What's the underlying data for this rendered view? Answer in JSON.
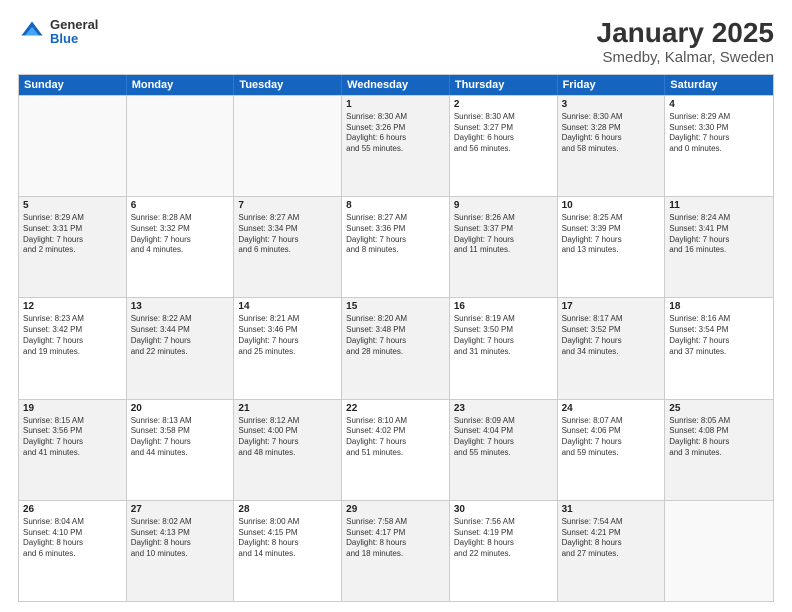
{
  "logo": {
    "general": "General",
    "blue": "Blue"
  },
  "title": "January 2025",
  "subtitle": "Smedby, Kalmar, Sweden",
  "weekdays": [
    "Sunday",
    "Monday",
    "Tuesday",
    "Wednesday",
    "Thursday",
    "Friday",
    "Saturday"
  ],
  "rows": [
    [
      {
        "day": "",
        "info": "",
        "empty": true
      },
      {
        "day": "",
        "info": "",
        "empty": true
      },
      {
        "day": "",
        "info": "",
        "empty": true
      },
      {
        "day": "1",
        "info": "Sunrise: 8:30 AM\nSunset: 3:26 PM\nDaylight: 6 hours\nand 55 minutes.",
        "shaded": true
      },
      {
        "day": "2",
        "info": "Sunrise: 8:30 AM\nSunset: 3:27 PM\nDaylight: 6 hours\nand 56 minutes.",
        "shaded": false
      },
      {
        "day": "3",
        "info": "Sunrise: 8:30 AM\nSunset: 3:28 PM\nDaylight: 6 hours\nand 58 minutes.",
        "shaded": true
      },
      {
        "day": "4",
        "info": "Sunrise: 8:29 AM\nSunset: 3:30 PM\nDaylight: 7 hours\nand 0 minutes.",
        "shaded": false
      }
    ],
    [
      {
        "day": "5",
        "info": "Sunrise: 8:29 AM\nSunset: 3:31 PM\nDaylight: 7 hours\nand 2 minutes.",
        "shaded": true
      },
      {
        "day": "6",
        "info": "Sunrise: 8:28 AM\nSunset: 3:32 PM\nDaylight: 7 hours\nand 4 minutes.",
        "shaded": false
      },
      {
        "day": "7",
        "info": "Sunrise: 8:27 AM\nSunset: 3:34 PM\nDaylight: 7 hours\nand 6 minutes.",
        "shaded": true
      },
      {
        "day": "8",
        "info": "Sunrise: 8:27 AM\nSunset: 3:36 PM\nDaylight: 7 hours\nand 8 minutes.",
        "shaded": false
      },
      {
        "day": "9",
        "info": "Sunrise: 8:26 AM\nSunset: 3:37 PM\nDaylight: 7 hours\nand 11 minutes.",
        "shaded": true
      },
      {
        "day": "10",
        "info": "Sunrise: 8:25 AM\nSunset: 3:39 PM\nDaylight: 7 hours\nand 13 minutes.",
        "shaded": false
      },
      {
        "day": "11",
        "info": "Sunrise: 8:24 AM\nSunset: 3:41 PM\nDaylight: 7 hours\nand 16 minutes.",
        "shaded": true
      }
    ],
    [
      {
        "day": "12",
        "info": "Sunrise: 8:23 AM\nSunset: 3:42 PM\nDaylight: 7 hours\nand 19 minutes.",
        "shaded": false
      },
      {
        "day": "13",
        "info": "Sunrise: 8:22 AM\nSunset: 3:44 PM\nDaylight: 7 hours\nand 22 minutes.",
        "shaded": true
      },
      {
        "day": "14",
        "info": "Sunrise: 8:21 AM\nSunset: 3:46 PM\nDaylight: 7 hours\nand 25 minutes.",
        "shaded": false
      },
      {
        "day": "15",
        "info": "Sunrise: 8:20 AM\nSunset: 3:48 PM\nDaylight: 7 hours\nand 28 minutes.",
        "shaded": true
      },
      {
        "day": "16",
        "info": "Sunrise: 8:19 AM\nSunset: 3:50 PM\nDaylight: 7 hours\nand 31 minutes.",
        "shaded": false
      },
      {
        "day": "17",
        "info": "Sunrise: 8:17 AM\nSunset: 3:52 PM\nDaylight: 7 hours\nand 34 minutes.",
        "shaded": true
      },
      {
        "day": "18",
        "info": "Sunrise: 8:16 AM\nSunset: 3:54 PM\nDaylight: 7 hours\nand 37 minutes.",
        "shaded": false
      }
    ],
    [
      {
        "day": "19",
        "info": "Sunrise: 8:15 AM\nSunset: 3:56 PM\nDaylight: 7 hours\nand 41 minutes.",
        "shaded": true
      },
      {
        "day": "20",
        "info": "Sunrise: 8:13 AM\nSunset: 3:58 PM\nDaylight: 7 hours\nand 44 minutes.",
        "shaded": false
      },
      {
        "day": "21",
        "info": "Sunrise: 8:12 AM\nSunset: 4:00 PM\nDaylight: 7 hours\nand 48 minutes.",
        "shaded": true
      },
      {
        "day": "22",
        "info": "Sunrise: 8:10 AM\nSunset: 4:02 PM\nDaylight: 7 hours\nand 51 minutes.",
        "shaded": false
      },
      {
        "day": "23",
        "info": "Sunrise: 8:09 AM\nSunset: 4:04 PM\nDaylight: 7 hours\nand 55 minutes.",
        "shaded": true
      },
      {
        "day": "24",
        "info": "Sunrise: 8:07 AM\nSunset: 4:06 PM\nDaylight: 7 hours\nand 59 minutes.",
        "shaded": false
      },
      {
        "day": "25",
        "info": "Sunrise: 8:05 AM\nSunset: 4:08 PM\nDaylight: 8 hours\nand 3 minutes.",
        "shaded": true
      }
    ],
    [
      {
        "day": "26",
        "info": "Sunrise: 8:04 AM\nSunset: 4:10 PM\nDaylight: 8 hours\nand 6 minutes.",
        "shaded": false
      },
      {
        "day": "27",
        "info": "Sunrise: 8:02 AM\nSunset: 4:13 PM\nDaylight: 8 hours\nand 10 minutes.",
        "shaded": true
      },
      {
        "day": "28",
        "info": "Sunrise: 8:00 AM\nSunset: 4:15 PM\nDaylight: 8 hours\nand 14 minutes.",
        "shaded": false
      },
      {
        "day": "29",
        "info": "Sunrise: 7:58 AM\nSunset: 4:17 PM\nDaylight: 8 hours\nand 18 minutes.",
        "shaded": true
      },
      {
        "day": "30",
        "info": "Sunrise: 7:56 AM\nSunset: 4:19 PM\nDaylight: 8 hours\nand 22 minutes.",
        "shaded": false
      },
      {
        "day": "31",
        "info": "Sunrise: 7:54 AM\nSunset: 4:21 PM\nDaylight: 8 hours\nand 27 minutes.",
        "shaded": true
      },
      {
        "day": "",
        "info": "",
        "empty": true
      }
    ]
  ]
}
